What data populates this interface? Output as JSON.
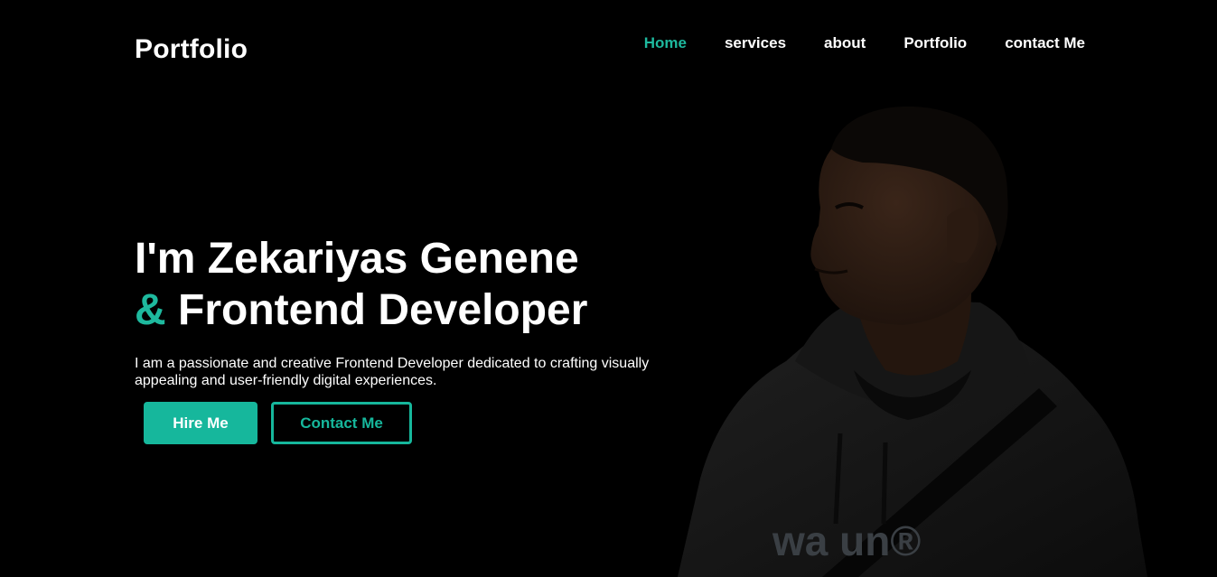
{
  "header": {
    "logo": "Portfolio",
    "nav": [
      {
        "label": "Home",
        "active": true
      },
      {
        "label": "services",
        "active": false
      },
      {
        "label": "about",
        "active": false
      },
      {
        "label": "Portfolio",
        "active": false
      },
      {
        "label": "contact Me",
        "active": false
      }
    ]
  },
  "hero": {
    "title_line1": "I'm Zekariyas Genene",
    "ampersand": "&",
    "title_line2": "Frontend Developer",
    "description": "I am a passionate and creative Frontend Developer dedicated to crafting visually appealing and user-friendly digital experiences.",
    "hire_button": "Hire Me",
    "contact_button": "Contact Me",
    "photo_shirt_text": "wa   un®"
  },
  "colors": {
    "accent": "#16b79c",
    "background": "#000000",
    "text": "#ffffff"
  },
  "icons": [
    "portrait-photo"
  ]
}
